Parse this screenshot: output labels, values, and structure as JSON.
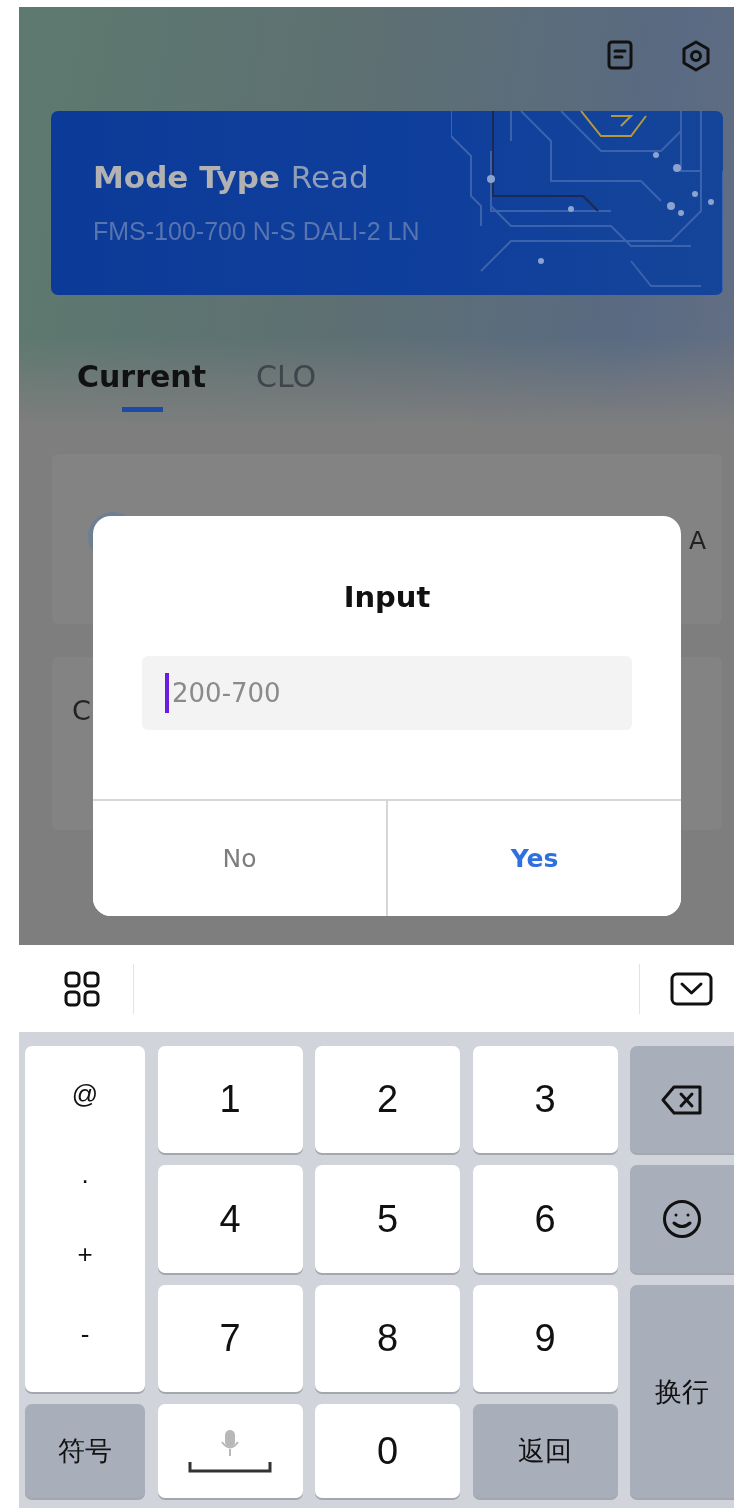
{
  "banner": {
    "title": "Mode Type",
    "mode": "Read",
    "model": "FMS-100-700 N-S DALI-2 LN"
  },
  "tabs": [
    {
      "label": "Current",
      "selected": true
    },
    {
      "label": "CLO",
      "selected": false
    }
  ],
  "cards": [
    {
      "kind": "channel",
      "value": "A"
    },
    {
      "kind": "label",
      "title": "C"
    }
  ],
  "dialog": {
    "title": "Input",
    "field": {
      "placeholder": "200-700"
    },
    "buttons": [
      {
        "label": "No",
        "kind": "cancel"
      },
      {
        "label": "Yes",
        "kind": "confirm"
      }
    ]
  },
  "keyboard": {
    "symbols": [
      "@",
      ".",
      "+",
      "-"
    ],
    "keys": [
      {
        "kind": "digit",
        "label": "1"
      },
      {
        "kind": "digit",
        "label": "2"
      },
      {
        "kind": "digit",
        "label": "3"
      },
      {
        "kind": "delete"
      },
      {
        "kind": "digit",
        "label": "4"
      },
      {
        "kind": "digit",
        "label": "5"
      },
      {
        "kind": "digit",
        "label": "6"
      },
      {
        "kind": "emoji"
      },
      {
        "kind": "digit",
        "label": "7"
      },
      {
        "kind": "digit",
        "label": "8"
      },
      {
        "kind": "digit",
        "label": "9"
      },
      {
        "kind": "enter",
        "label": "换行"
      },
      {
        "kind": "function",
        "label": "符号"
      },
      {
        "kind": "space"
      },
      {
        "kind": "digit",
        "label": "0"
      },
      {
        "kind": "function",
        "label": "返回"
      }
    ]
  }
}
